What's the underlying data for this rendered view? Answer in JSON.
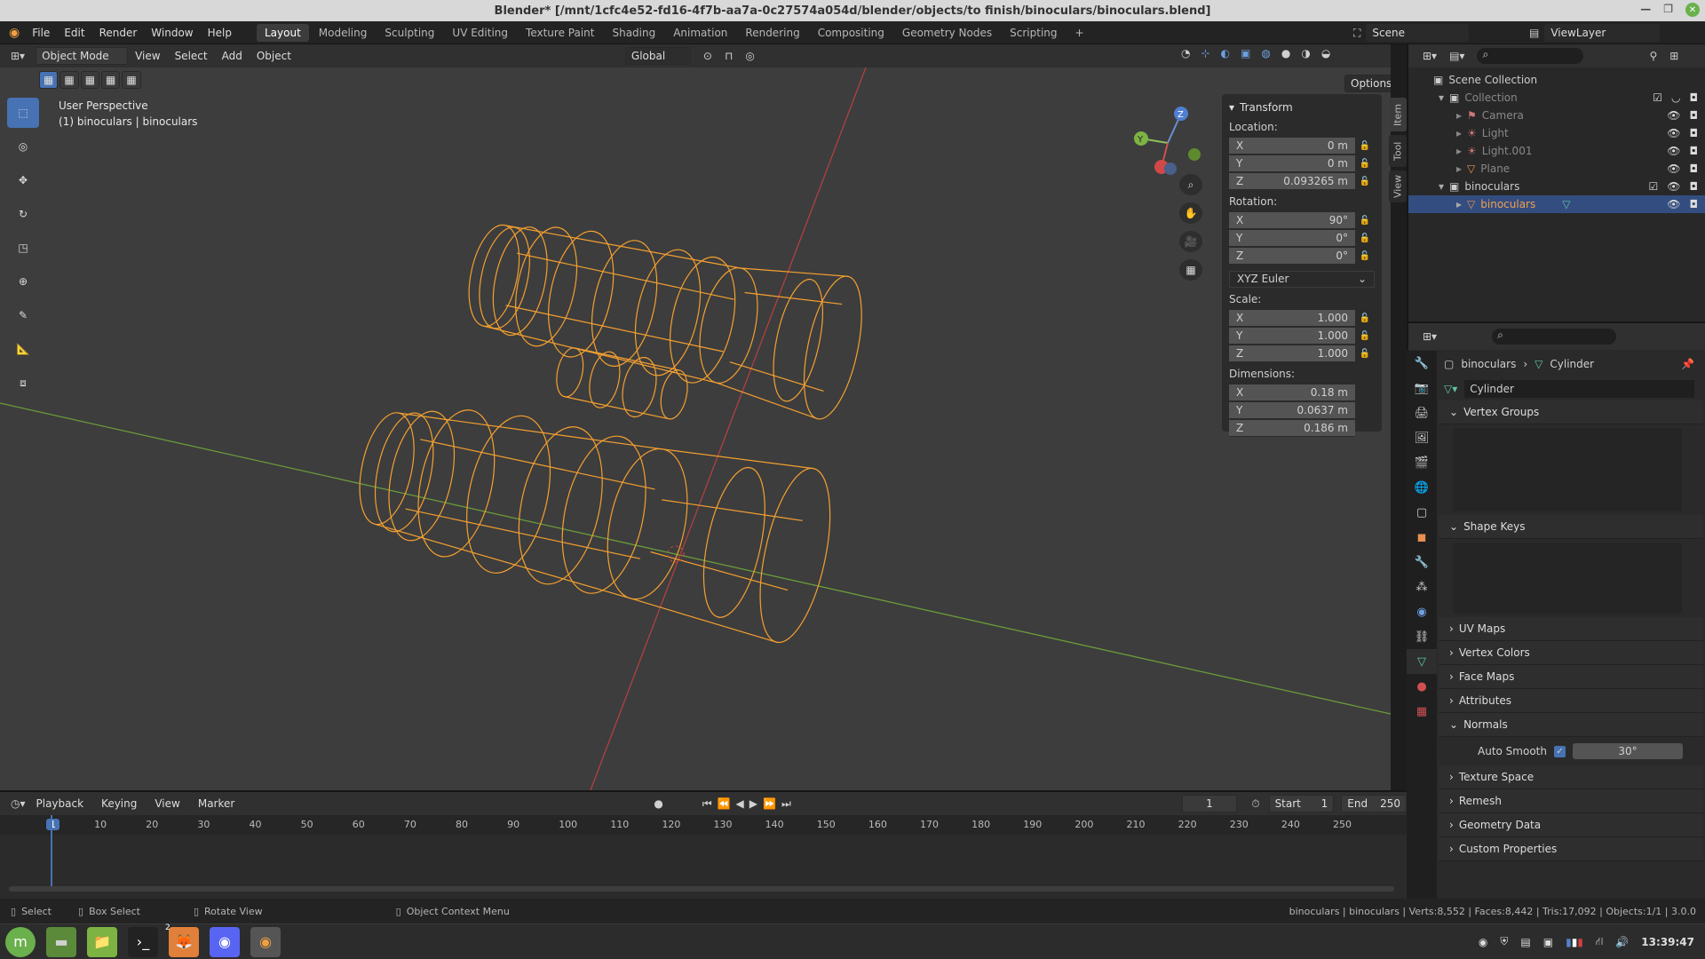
{
  "window": {
    "title": "Blender* [/mnt/1cfc4e52-fd16-4f7b-aa7a-0c27574a054d/blender/objects/to finish/binoculars/binoculars.blend]"
  },
  "menu": [
    "File",
    "Edit",
    "Render",
    "Window",
    "Help"
  ],
  "workspaces": [
    "Layout",
    "Modeling",
    "Sculpting",
    "UV Editing",
    "Texture Paint",
    "Shading",
    "Animation",
    "Rendering",
    "Compositing",
    "Geometry Nodes",
    "Scripting"
  ],
  "active_workspace": "Layout",
  "scene": {
    "label": "Scene",
    "viewlayer": "ViewLayer"
  },
  "viewport_header": {
    "mode": "Object Mode",
    "items": [
      "View",
      "Select",
      "Add",
      "Object"
    ],
    "orientation": "Global",
    "options": "Options"
  },
  "viewport": {
    "perspective": "User Perspective",
    "object_info": "(1) binoculars | binoculars"
  },
  "npanel": {
    "section": "Transform",
    "location_label": "Location:",
    "location": [
      {
        "axis": "X",
        "value": "0 m"
      },
      {
        "axis": "Y",
        "value": "0 m"
      },
      {
        "axis": "Z",
        "value": "0.093265 m"
      }
    ],
    "rotation_label": "Rotation:",
    "rotation": [
      {
        "axis": "X",
        "value": "90°"
      },
      {
        "axis": "Y",
        "value": "0°"
      },
      {
        "axis": "Z",
        "value": "0°"
      }
    ],
    "rotation_mode": "XYZ Euler",
    "scale_label": "Scale:",
    "scale": [
      {
        "axis": "X",
        "value": "1.000"
      },
      {
        "axis": "Y",
        "value": "1.000"
      },
      {
        "axis": "Z",
        "value": "1.000"
      }
    ],
    "dimensions_label": "Dimensions:",
    "dimensions": [
      {
        "axis": "X",
        "value": "0.18 m"
      },
      {
        "axis": "Y",
        "value": "0.0637 m"
      },
      {
        "axis": "Z",
        "value": "0.186 m"
      }
    ],
    "tabs": [
      "Item",
      "Tool",
      "View"
    ]
  },
  "outliner": {
    "rows": [
      {
        "label": "Scene Collection",
        "indent": 0
      },
      {
        "label": "Collection",
        "indent": 1
      },
      {
        "label": "Camera",
        "indent": 2
      },
      {
        "label": "Light",
        "indent": 2
      },
      {
        "label": "Light.001",
        "indent": 2
      },
      {
        "label": "Plane",
        "indent": 2
      },
      {
        "label": "binoculars",
        "indent": 1
      },
      {
        "label": "binoculars",
        "indent": 2
      }
    ]
  },
  "properties": {
    "breadcrumb_object": "binoculars",
    "breadcrumb_data": "Cylinder",
    "mesh_name": "Cylinder",
    "sections": [
      "Vertex Groups",
      "Shape Keys",
      "UV Maps",
      "Vertex Colors",
      "Face Maps",
      "Attributes",
      "Normals",
      "Texture Space",
      "Remesh",
      "Geometry Data",
      "Custom Properties"
    ],
    "auto_smooth_label": "Auto Smooth",
    "auto_smooth_angle": "30°"
  },
  "timeline": {
    "menus": [
      "Playback",
      "Keying",
      "View",
      "Marker"
    ],
    "current_frame": "1",
    "start_label": "Start",
    "start": "1",
    "end_label": "End",
    "end": "250",
    "ticks": [
      "1",
      "10",
      "20",
      "30",
      "40",
      "50",
      "60",
      "70",
      "80",
      "90",
      "100",
      "110",
      "120",
      "130",
      "140",
      "150",
      "160",
      "170",
      "180",
      "190",
      "200",
      "210",
      "220",
      "230",
      "240",
      "250"
    ]
  },
  "statusbar": {
    "select": "Select",
    "box_select": "Box Select",
    "rotate_view": "Rotate View",
    "context_menu": "Object Context Menu",
    "stats": "binoculars | binoculars | Verts:8,552 | Faces:8,442 | Tris:17,092 | Objects:1/1 | 3.0.0"
  },
  "taskbar": {
    "clock": "13:39:47",
    "badge": "2"
  },
  "colors": {
    "accent": "#4772b3",
    "wire": "#f5a030",
    "selected_row": "#334d80"
  }
}
